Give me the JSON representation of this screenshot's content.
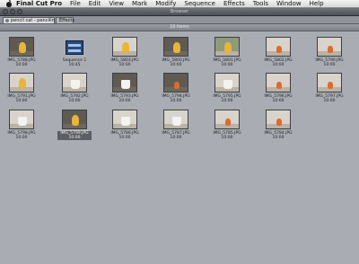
{
  "menubar": {
    "app": "Final Cut Pro",
    "items": [
      "File",
      "Edit",
      "View",
      "Mark",
      "Modify",
      "Sequence",
      "Effects",
      "Tools",
      "Window",
      "Help"
    ]
  },
  "window": {
    "title": "Browser"
  },
  "tabs": [
    {
      "label": "pencil cat - pencilin",
      "active": true
    },
    {
      "label": "Effects",
      "active": false
    }
  ],
  "header": {
    "label": "16 items"
  },
  "clips": [
    {
      "name": "IMG_5788.JPG",
      "time": "10:00",
      "kind": "photo",
      "scene": "duck-dark"
    },
    {
      "name": "Sequence 1",
      "time": "10:45",
      "kind": "sequence"
    },
    {
      "name": "IMG_5803.JPG",
      "time": "10:00",
      "kind": "photo",
      "scene": "duck"
    },
    {
      "name": "IMG_5800.JPG",
      "time": "10:00",
      "kind": "photo",
      "scene": "duck-dark"
    },
    {
      "name": "IMG_5801.JPG",
      "time": "10:00",
      "kind": "photo",
      "scene": "duck-tree"
    },
    {
      "name": "IMG_5802.JPG",
      "time": "10:00",
      "kind": "photo",
      "scene": "orange"
    },
    {
      "name": "IMG_5790.JPG",
      "time": "10:00",
      "kind": "photo",
      "scene": "orange"
    },
    {
      "name": "IMG_5791.JPG",
      "time": "10:00",
      "kind": "photo",
      "scene": "duck"
    },
    {
      "name": "IMG_5792.JPG",
      "time": "10:00",
      "kind": "photo",
      "scene": "cup"
    },
    {
      "name": "IMG_5793.JPG",
      "time": "10:00",
      "kind": "photo",
      "scene": "cup-dark"
    },
    {
      "name": "IMG_5794.JPG",
      "time": "10:00",
      "kind": "photo",
      "scene": "orange-dark"
    },
    {
      "name": "IMG_5795.JPG",
      "time": "10:00",
      "kind": "photo",
      "scene": "cup"
    },
    {
      "name": "IMG_5796.JPG",
      "time": "10:00",
      "kind": "photo",
      "scene": "orange"
    },
    {
      "name": "IMG_5797.JPG",
      "time": "10:00",
      "kind": "photo",
      "scene": "orange"
    },
    {
      "name": "IMG_5798.JPG",
      "time": "10:00",
      "kind": "photo",
      "scene": "cup"
    },
    {
      "name": "IMG_5799.JPG",
      "time": "10:00",
      "kind": "photo",
      "scene": "duck-dark",
      "selected": true
    },
    {
      "name": "IMG_5786.JPG",
      "time": "10:00",
      "kind": "photo",
      "scene": "cup"
    },
    {
      "name": "IMG_5787.JPG",
      "time": "10:00",
      "kind": "photo",
      "scene": "cup"
    },
    {
      "name": "IMG_5785.JPG",
      "time": "10:00",
      "kind": "photo",
      "scene": "orange"
    },
    {
      "name": "IMG_5784.JPG",
      "time": "10:00",
      "kind": "photo",
      "scene": "orange"
    }
  ],
  "colors": {
    "background": "#a9adb3",
    "duck": "#e8b53a",
    "orange": "#e06a2a",
    "cup": "#f3f3f0"
  }
}
